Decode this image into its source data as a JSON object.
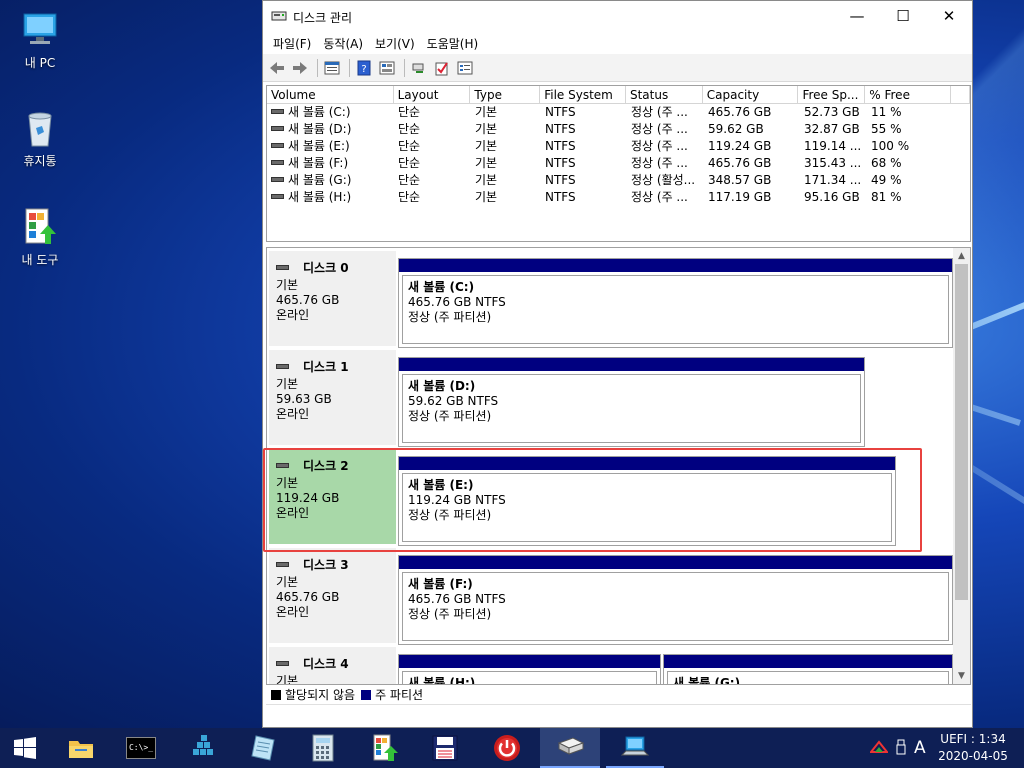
{
  "desktop": {
    "icons": [
      {
        "label": "내 PC",
        "icon": "computer-icon"
      },
      {
        "label": "휴지통",
        "icon": "recycle-bin-icon"
      },
      {
        "label": "내 도구",
        "icon": "tools-icon"
      }
    ]
  },
  "window": {
    "title": "디스크 관리",
    "controls": {
      "minimize": "—",
      "maximize": "☐",
      "close": "✕"
    },
    "menu": [
      "파일(F)",
      "동작(A)",
      "보기(V)",
      "도움말(H)"
    ],
    "toolbar_icons": [
      "back-arrow-icon",
      "forward-arrow-icon",
      "properties-icon",
      "help-icon",
      "view-icon",
      "connect-icon",
      "check-icon",
      "settings-icon"
    ]
  },
  "volume_list": {
    "columns": [
      "Volume",
      "Layout",
      "Type",
      "File System",
      "Status",
      "Capacity",
      "Free Sp...",
      "% Free"
    ],
    "rows": [
      {
        "volume": "새 볼륨 (C:)",
        "layout": "단순",
        "type": "기본",
        "fs": "NTFS",
        "status": "정상 (주 ...",
        "capacity": "465.76 GB",
        "free": "52.73 GB",
        "pct": "11 %"
      },
      {
        "volume": "새 볼륨 (D:)",
        "layout": "단순",
        "type": "기본",
        "fs": "NTFS",
        "status": "정상 (주 ...",
        "capacity": "59.62 GB",
        "free": "32.87 GB",
        "pct": "55 %"
      },
      {
        "volume": "새 볼륨 (E:)",
        "layout": "단순",
        "type": "기본",
        "fs": "NTFS",
        "status": "정상 (주 ...",
        "capacity": "119.24 GB",
        "free": "119.14 ...",
        "pct": "100 %"
      },
      {
        "volume": "새 볼륨 (F:)",
        "layout": "단순",
        "type": "기본",
        "fs": "NTFS",
        "status": "정상 (주 ...",
        "capacity": "465.76 GB",
        "free": "315.43 ...",
        "pct": "68 %"
      },
      {
        "volume": "새 볼륨 (G:)",
        "layout": "단순",
        "type": "기본",
        "fs": "NTFS",
        "status": "정상 (활성...",
        "capacity": "348.57 GB",
        "free": "171.34 ...",
        "pct": "49 %"
      },
      {
        "volume": "새 볼륨 (H:)",
        "layout": "단순",
        "type": "기본",
        "fs": "NTFS",
        "status": "정상 (주 ...",
        "capacity": "117.19 GB",
        "free": "95.16 GB",
        "pct": "81 %"
      }
    ]
  },
  "disks": [
    {
      "name": "디스크 0",
      "type": "기본",
      "size": "465.76 GB",
      "state": "온라인",
      "partitions": [
        {
          "name": "새 볼륨  (C:)",
          "size": "465.76 GB NTFS",
          "status": "정상 (주 파티션)"
        }
      ]
    },
    {
      "name": "디스크 1",
      "type": "기본",
      "size": "59.63 GB",
      "state": "온라인",
      "partitions": [
        {
          "name": "새 볼륨  (D:)",
          "size": "59.62 GB NTFS",
          "status": "정상 (주 파티션)"
        }
      ]
    },
    {
      "name": "디스크 2",
      "type": "기본",
      "size": "119.24 GB",
      "state": "온라인",
      "partitions": [
        {
          "name": "새 볼륨  (E:)",
          "size": "119.24 GB NTFS",
          "status": "정상 (주 파티션)"
        }
      ]
    },
    {
      "name": "디스크 3",
      "type": "기본",
      "size": "465.76 GB",
      "state": "온라인",
      "partitions": [
        {
          "name": "새 볼륨  (F:)",
          "size": "465.76 GB NTFS",
          "status": "정상 (주 파티션)"
        }
      ]
    },
    {
      "name": "디스크 4",
      "type": "기본",
      "size": "",
      "state": "",
      "partitions": [
        {
          "name": "새 볼륨  (H:)",
          "size": "",
          "status": ""
        },
        {
          "name": "새 볼륨  (G:)",
          "size": "",
          "status": ""
        }
      ]
    }
  ],
  "legend": {
    "unallocated": "할당되지 않음",
    "primary": "주 파티션",
    "unallocated_color": "#000000",
    "primary_color": "#000080"
  },
  "taskbar": {
    "apps": [
      "windows-start-icon",
      "file-explorer-icon",
      "command-prompt-icon",
      "cube-app-icon",
      "notepad-icon",
      "calculator-icon",
      "tools-icon",
      "floppy-save-icon",
      "power-icon",
      "disk-management-icon",
      "network-computer-icon"
    ],
    "cmd_label": "C:\\>_",
    "tray_label": "A",
    "clock_line1": "UEFI : 1:34",
    "clock_line2": "2020-04-05"
  },
  "colors": {
    "selected_disk": "#a8d8a8",
    "highlight_border": "#e8423f",
    "partition_header": "#000080"
  }
}
